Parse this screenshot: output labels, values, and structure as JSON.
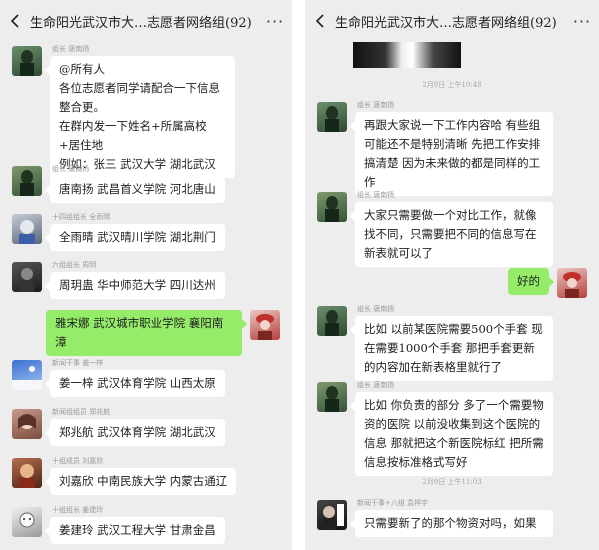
{
  "chat": {
    "title": "生命阳光武汉市大…志愿者网络组(92)",
    "more": "···"
  },
  "left": {
    "messages": [
      {
        "sender": "组长 唐南扬",
        "text": "@所有人\n各位志愿者同学请配合一下信息整合更。\n在群内发一下姓名+所属高校+居住地\n例如：张三 武汉大学 湖北武汉"
      },
      {
        "sender": "组长 唐南扬",
        "text": "唐南扬 武昌首义学院 河北唐山"
      },
      {
        "sender": "十四组组长 全雨晴",
        "text": "全雨晴 武汉晴川学院 湖北荆门"
      },
      {
        "sender": "六组组长 周玥",
        "text": "周玥蛊 华中师范大学 四川达州"
      },
      {
        "text": "雅宋娜 武汉城市职业学院 襄阳南漳"
      },
      {
        "sender": "新闻干事 姜一梓",
        "text": "姜一梓 武汉体育学院 山西太原"
      },
      {
        "sender": "新闻组组员 郑兆航",
        "text": "郑兆航 武汉体育学院 湖北武汉"
      },
      {
        "sender": "十组成员 刘嘉欣",
        "text": "刘嘉欣 中南民族大学 内蒙古通辽"
      },
      {
        "sender": "十组组长 姜建玲",
        "text": "姜建玲 武汉工程大学 甘肃金昌"
      }
    ]
  },
  "right": {
    "timestamps": [
      "2月9日 上午10:48",
      "2月9日 上午11:03"
    ],
    "messages": [
      {
        "sender": "组长 唐南扬",
        "text": "再跟大家说一下工作内容哈 有些组可能还不是特别清晰 先把工作安排搞清楚 因为未来做的都是同样的工作"
      },
      {
        "sender": "组长 唐南扬",
        "text": "大家只需要做一个对比工作，就像找不同，只需要把不同的信息写在新表就可以了"
      },
      {
        "text": "好的"
      },
      {
        "sender": "组长 唐南扬",
        "text": "比如 以前某医院需要500个手套 现在需要1000个手套 那把手套更新的内容加在新表格里就行了"
      },
      {
        "sender": "组长 唐南扬",
        "text": "比如 你负责的部分 多了一个需要物资的医院 以前没收集到这个医院的信息 那就把这个新医院标红 把所需信息按标准格式写好"
      },
      {
        "sender": "新闻干事+八组 袁祥宇",
        "text": "只需要新了的那个物资对吗，如果"
      }
    ]
  }
}
